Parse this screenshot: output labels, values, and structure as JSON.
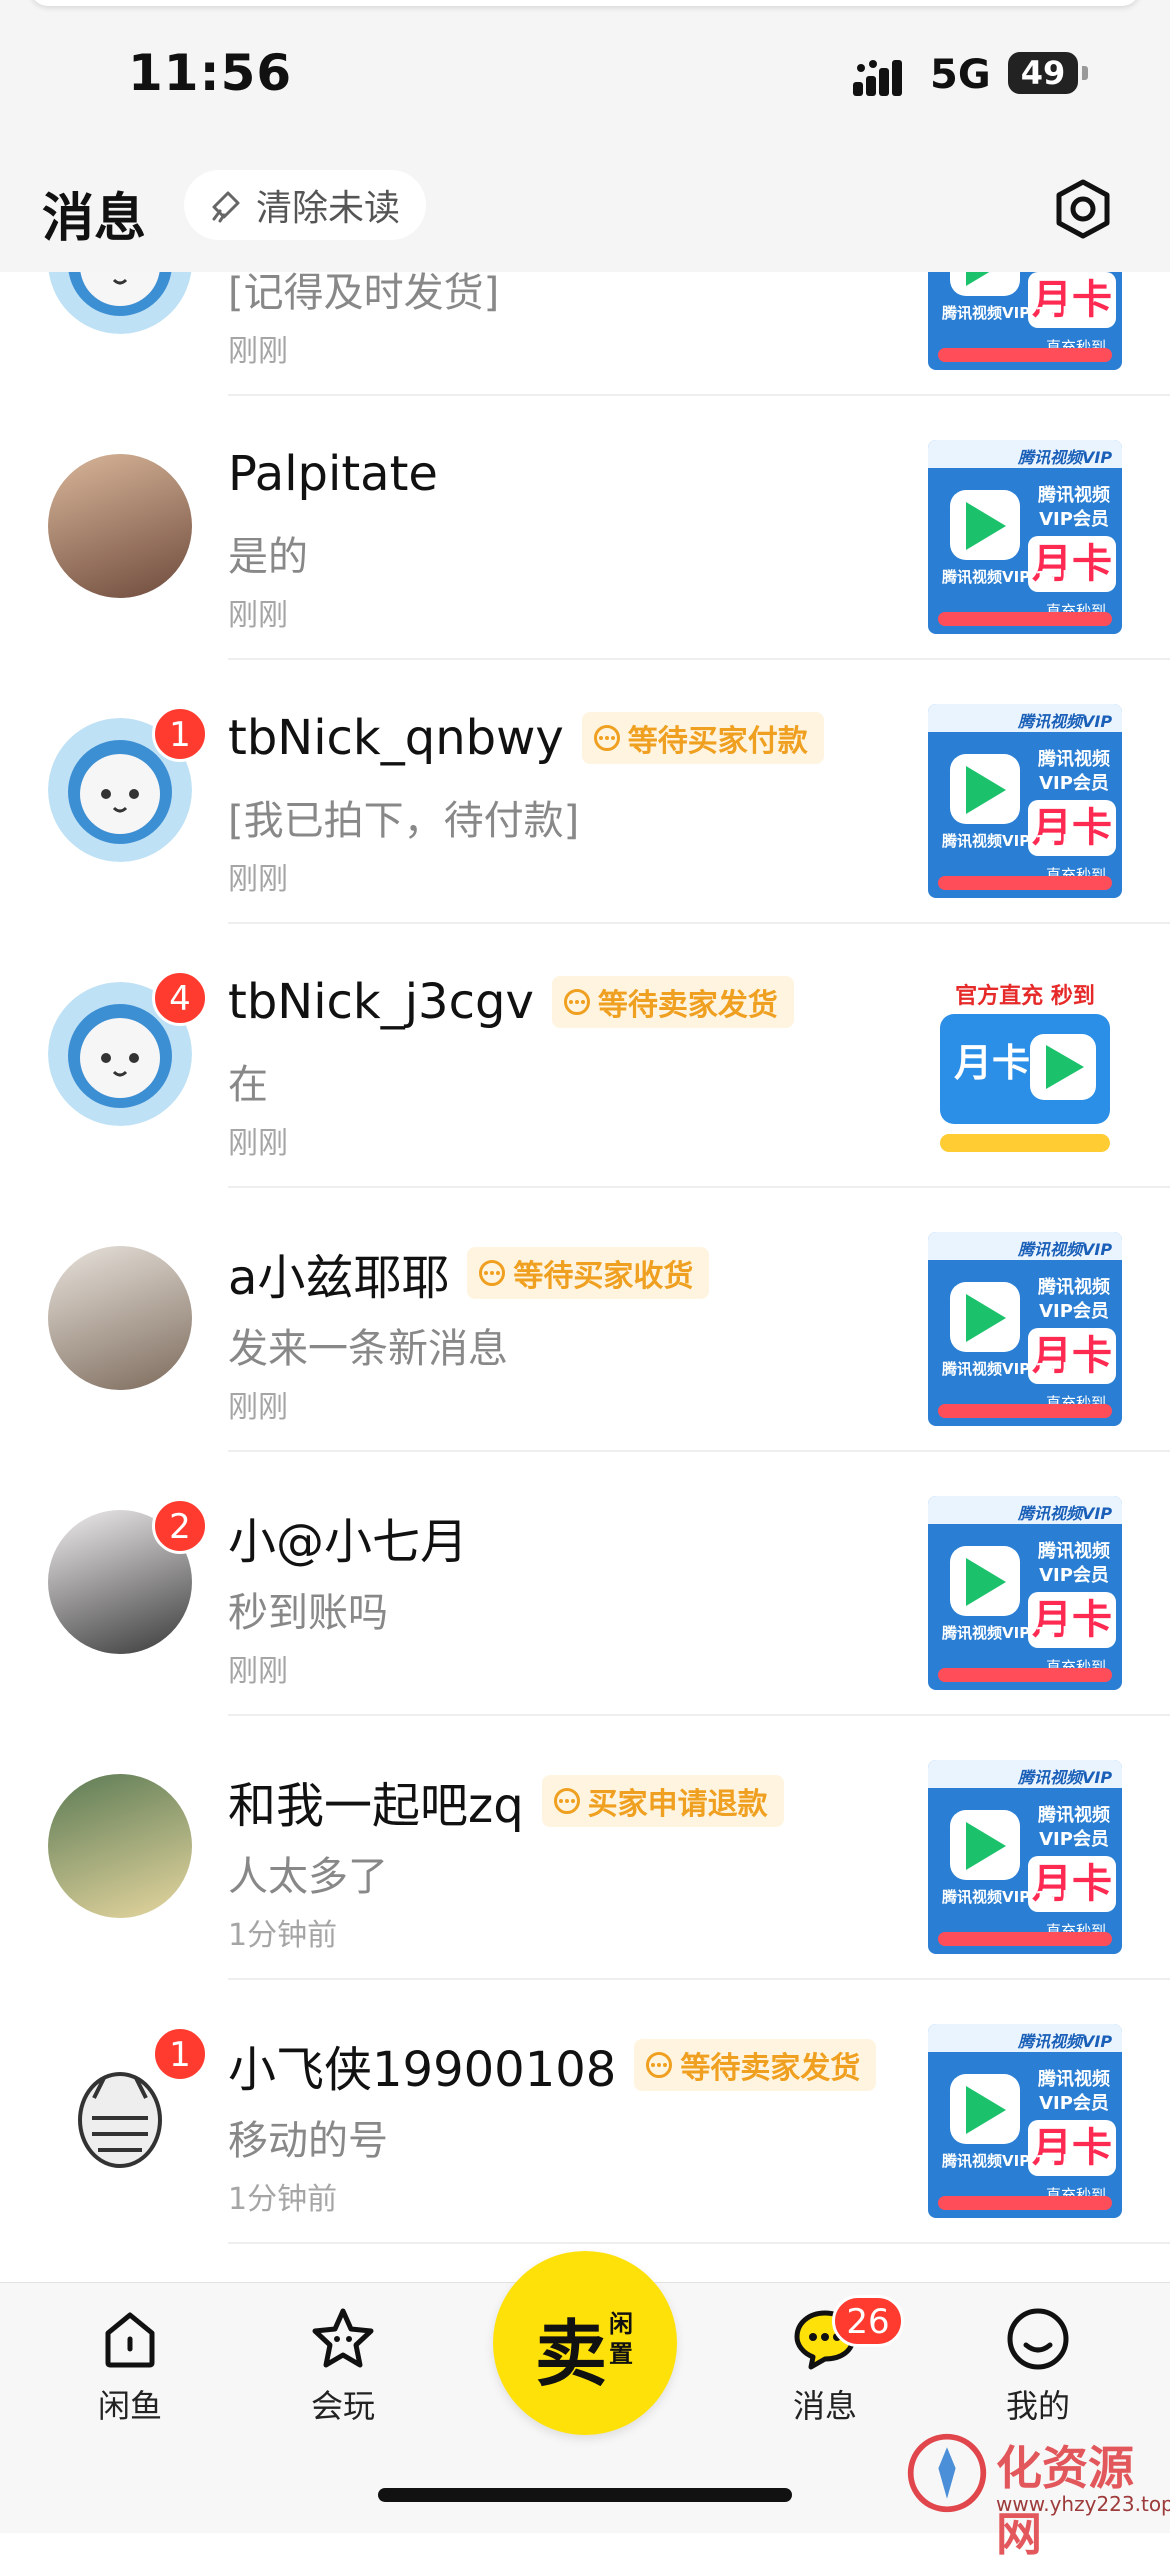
{
  "status_bar": {
    "time": "11:56",
    "network": "5G",
    "battery": "49"
  },
  "header": {
    "title": "消息",
    "clear_unread": "清除未读",
    "settings_icon": "gear-icon"
  },
  "conversations": [
    {
      "name": "",
      "message": "[记得及时发货]",
      "time": "刚刚",
      "badge": "",
      "status": "",
      "avatar": "cat-astronaut",
      "thumb": "vip"
    },
    {
      "name": "Palpitate",
      "message": "是的",
      "time": "刚刚",
      "badge": "",
      "status": "",
      "avatar": "photo-girl",
      "thumb": "vip"
    },
    {
      "name": "tbNick_qnbwy",
      "message": "[我已拍下，待付款]",
      "time": "刚刚",
      "badge": "1",
      "status": "等待买家付款",
      "avatar": "cat-astronaut",
      "thumb": "vip"
    },
    {
      "name": "tbNick_j3cgv",
      "message": "在",
      "time": "刚刚",
      "badge": "4",
      "status": "等待卖家发货",
      "avatar": "cat-astronaut",
      "thumb": "alt"
    },
    {
      "name": "a小兹耶耶",
      "message": "发来一条新消息",
      "time": "刚刚",
      "badge": "",
      "status": "等待买家收货",
      "avatar": "photo-bride",
      "thumb": "vip"
    },
    {
      "name": "小@小七月",
      "message": "秒到账吗",
      "time": "刚刚",
      "badge": "2",
      "status": "",
      "avatar": "photo-girl2",
      "thumb": "vip"
    },
    {
      "name": "和我一起吧zq",
      "message": "人太多了",
      "time": "1分钟前",
      "badge": "",
      "status": "买家申请退款",
      "avatar": "illustration",
      "thumb": "vip"
    },
    {
      "name": "小飞侠19900108",
      "message": "移动的号",
      "time": "1分钟前",
      "badge": "1",
      "status": "等待卖家发货",
      "avatar": "cat-drawing",
      "thumb": "vip"
    }
  ],
  "thumb_vip": {
    "brand": "腾讯视频VIP",
    "title": "腾讯视频VIP会员",
    "card": "月卡",
    "duration": "腾讯视频VIP 1个月",
    "instant": "直充秒到"
  },
  "thumb_alt": {
    "top": "官方直充 秒到",
    "card": "月卡"
  },
  "tabbar": {
    "items": [
      {
        "label": "闲鱼",
        "icon": "home-icon"
      },
      {
        "label": "会玩",
        "icon": "star-face-icon"
      },
      {
        "label": "消息",
        "icon": "chat-bubble-icon",
        "badge": "26"
      },
      {
        "label": "我的",
        "icon": "smile-face-icon"
      }
    ],
    "sell": {
      "big": "卖",
      "small": "闲置"
    }
  },
  "watermark": {
    "text": "化资源网",
    "url": "www.yhzy223.top"
  },
  "colors": {
    "accent_yellow": "#ffe10a",
    "badge_red": "#ff3b30",
    "status_orange": "#f0a020",
    "vip_blue": "#2a7fd4"
  }
}
